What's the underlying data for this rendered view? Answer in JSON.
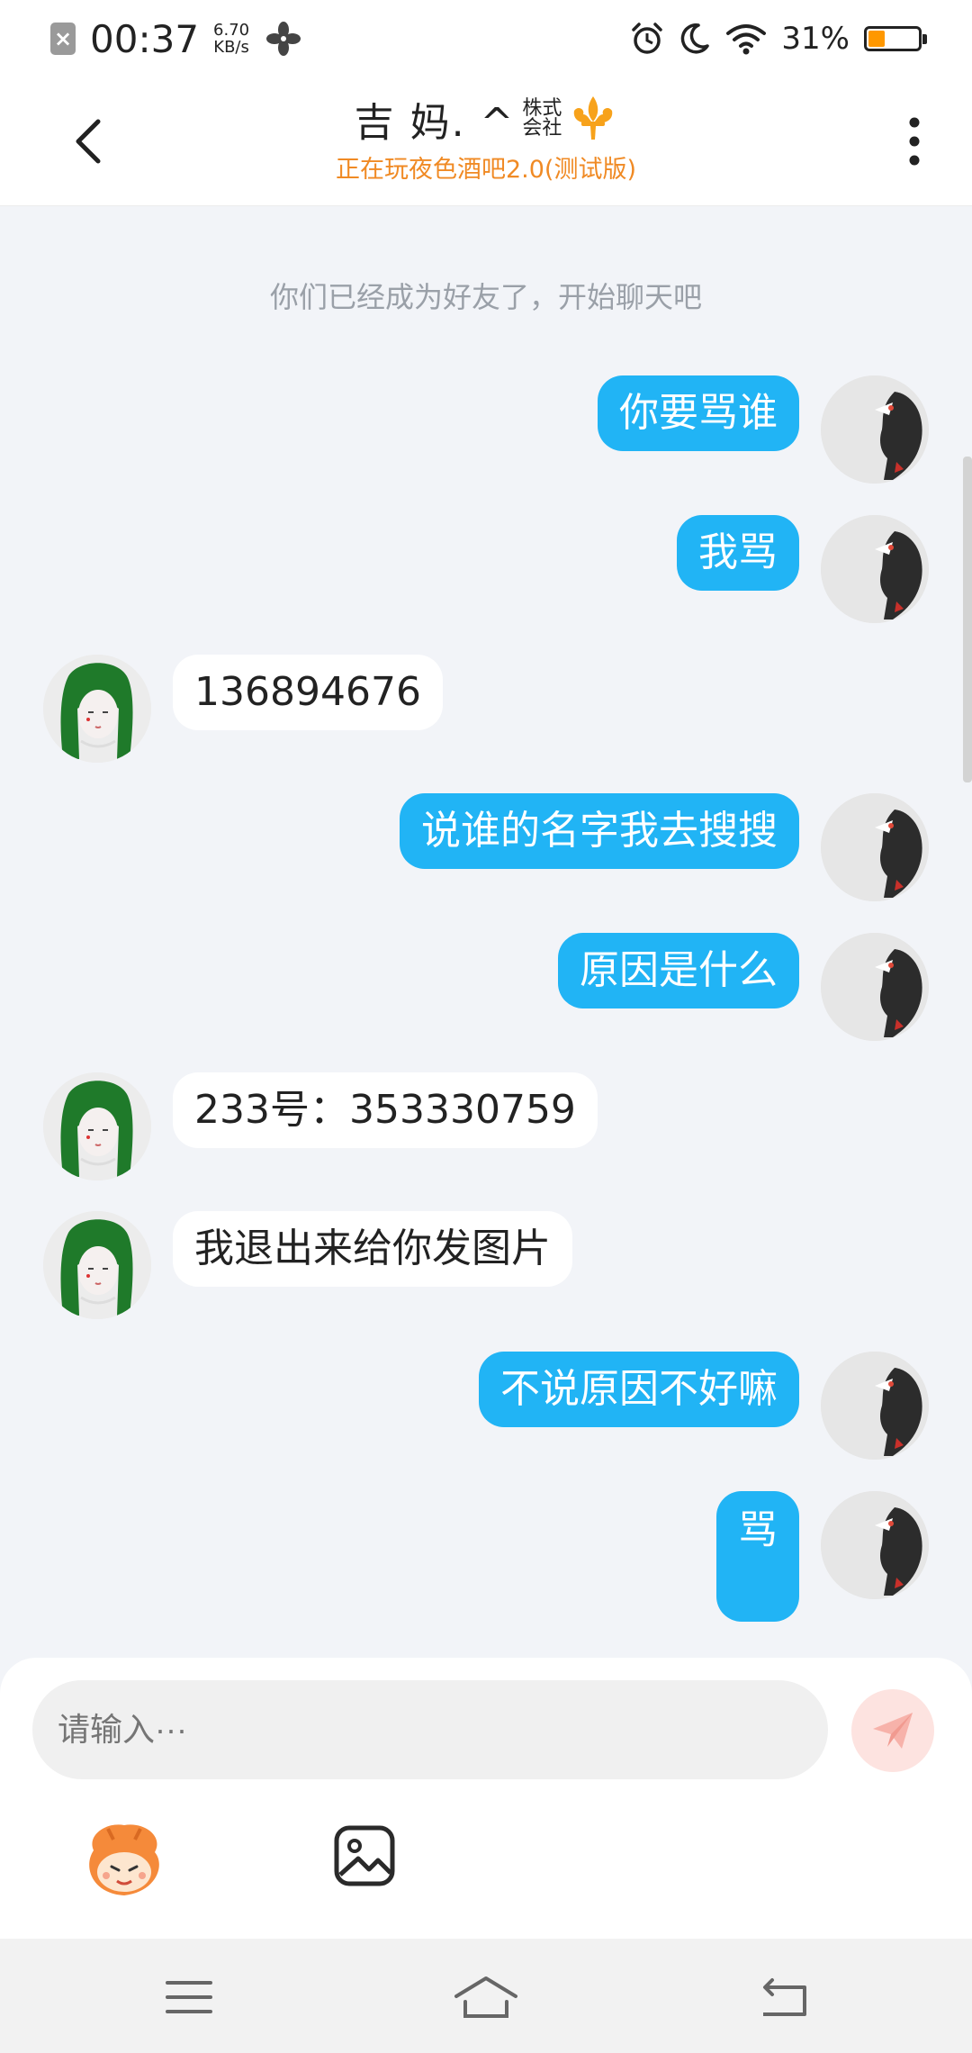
{
  "status_bar": {
    "close_icon_label": "×",
    "time": "00:37",
    "net_speed_value": "6.70",
    "net_speed_unit": "KB/s",
    "battery_percent": "31%",
    "battery_level": 0.31,
    "icons": [
      "app-close-icon",
      "fan-icon",
      "alarm-icon",
      "moon-icon",
      "wifi-icon",
      "battery-icon"
    ]
  },
  "header": {
    "title": "吉 妈. ^",
    "badge_line1": "株式",
    "badge_line2": "会社",
    "subtitle": "正在玩夜色酒吧2.0(测试版)",
    "back_icon": "chevron-left-icon",
    "more_icon": "more-vertical-icon"
  },
  "chat": {
    "system_message": "你们已经成为好友了，开始聊天吧",
    "messages": [
      {
        "sender": "me",
        "text": "你要骂谁"
      },
      {
        "sender": "me",
        "text": "我骂"
      },
      {
        "sender": "her",
        "text": "136894676"
      },
      {
        "sender": "me",
        "text": "说谁的名字我去搜搜"
      },
      {
        "sender": "me",
        "text": "原因是什么"
      },
      {
        "sender": "her",
        "text": "233号：353330759"
      },
      {
        "sender": "her",
        "text": "我退出来给你发图片"
      },
      {
        "sender": "me",
        "text": "不说原因不好嘛"
      },
      {
        "sender": "me",
        "text": "骂"
      }
    ]
  },
  "input": {
    "placeholder": "请输入···",
    "send_icon": "send-icon",
    "emoji_icon": "emoji-face-icon",
    "image_icon": "image-icon"
  },
  "nav": {
    "icons": [
      "menu-icon",
      "home-icon",
      "back-icon"
    ]
  },
  "colors": {
    "my_bubble": "#21b4f5",
    "her_bubble": "#ffffff",
    "chat_bg": "#f2f4f8",
    "subtitle": "#f08a24"
  }
}
